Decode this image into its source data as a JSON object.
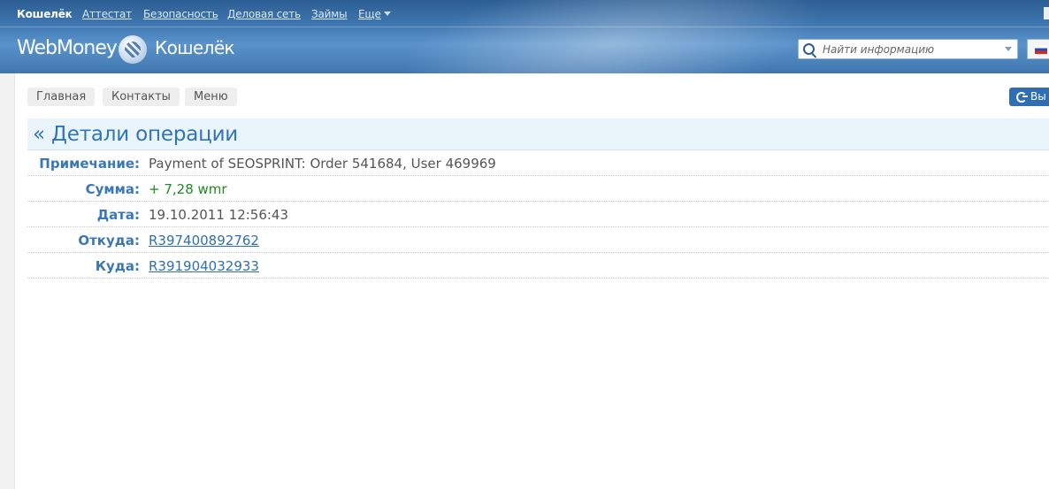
{
  "topnav": {
    "items": [
      "Кошелёк",
      "Аттестат",
      "Безопасность",
      "Деловая сеть",
      "Займы",
      "Еще"
    ]
  },
  "logo": {
    "brand": "WebMoney",
    "product": "Кошелёк"
  },
  "search": {
    "placeholder": "Найти информацию"
  },
  "subnav": {
    "home": "Главная",
    "contacts": "Контакты",
    "menu": "Меню",
    "logout": "Вы"
  },
  "page": {
    "title": "« Детали операции"
  },
  "details": {
    "note_label": "Примечание:",
    "note_value": "Payment of SEOSPRINT: Order 541684, User 469969",
    "amount_label": "Сумма:",
    "amount_value": "+ 7,28 wmr",
    "date_label": "Дата:",
    "date_value": "19.10.2011 12:56:43",
    "from_label": "Откуда:",
    "from_value": "R397400892762",
    "to_label": "Куда:",
    "to_value": "R391904032933"
  },
  "colors": {
    "header_blue": "#3d74ad",
    "label_blue": "#3a78b5",
    "amount_green": "#1f8a1f",
    "logout_blue": "#2f6eb3"
  }
}
